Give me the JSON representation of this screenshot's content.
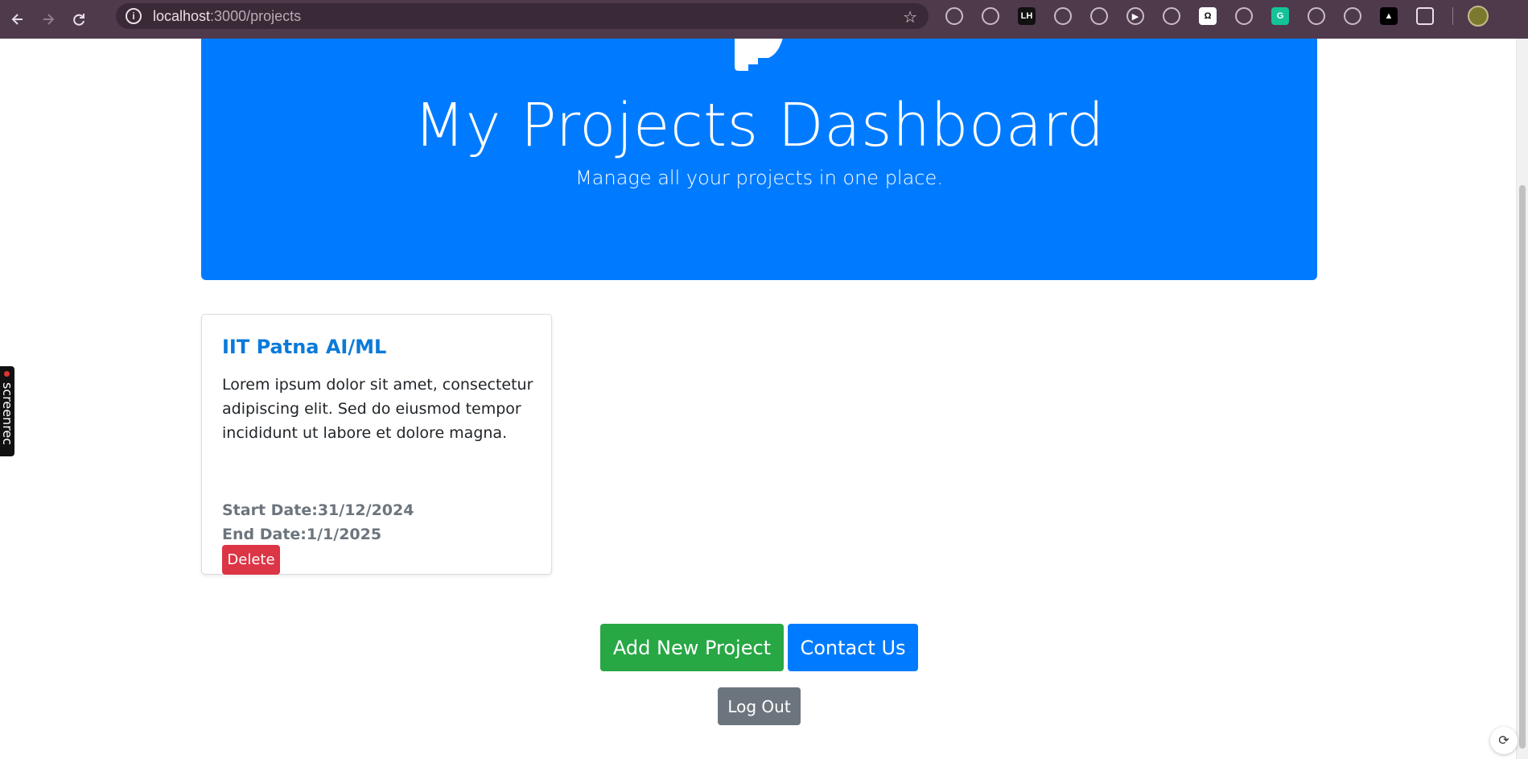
{
  "browser": {
    "url_host": "localhost",
    "url_path": ":3000/projects",
    "extensions": [
      {
        "name": "pixelate-icon",
        "color": "#4f3a4c",
        "text": ""
      },
      {
        "name": "capsule-icon",
        "color": "#4f3a4c",
        "text": ""
      },
      {
        "name": "lh-icon",
        "color": "#111111",
        "text": "LH"
      },
      {
        "name": "orange-snake-icon",
        "color": "#4f3a4c",
        "text": ""
      },
      {
        "name": "tree-icon",
        "color": "#4f3a4c",
        "text": ""
      },
      {
        "name": "play-icon",
        "color": "#4f3a4c",
        "text": "▶"
      },
      {
        "name": "helmet-icon",
        "color": "#4f3a4c",
        "text": ""
      },
      {
        "name": "omega-icon",
        "color": "#ffffff",
        "text": "Ω"
      },
      {
        "name": "window-icon",
        "color": "#4f3a4c",
        "text": ""
      },
      {
        "name": "grammarly-icon",
        "color": "#15c39a",
        "text": "G"
      },
      {
        "name": "brain-icon",
        "color": "#4f3a4c",
        "text": ""
      },
      {
        "name": "highlighter-icon",
        "color": "#4f3a4c",
        "text": ""
      },
      {
        "name": "triangle-icon",
        "color": "#000000",
        "text": "▲"
      },
      {
        "name": "puzzle-icon",
        "color": "#4f3a4c",
        "text": ""
      }
    ]
  },
  "hero": {
    "title": "My Projects Dashboard",
    "subtitle": "Manage all your projects in one place."
  },
  "projects": [
    {
      "title": "IIT Patna AI/ML",
      "description": "Lorem ipsum dolor sit amet, consectetur adipiscing elit. Sed do eiusmod tempor incididunt ut labore et dolore magna.",
      "start_date": "Start Date:31/12/2024",
      "end_date": "End Date:1/1/2025",
      "delete_label": "Delete"
    }
  ],
  "actions": {
    "add_label": "Add New Project",
    "contact_label": "Contact Us",
    "logout_label": "Log Out"
  },
  "overlay": {
    "screenrec_label": "screenrec"
  },
  "colors": {
    "primary": "#007bff",
    "success": "#28a745",
    "danger": "#dc3545",
    "secondary": "#6c757d"
  }
}
